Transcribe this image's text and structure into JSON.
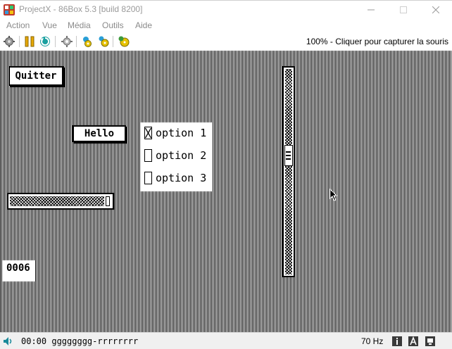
{
  "window": {
    "title": "ProjectX - 86Box 5.3 [build 8200]",
    "icon": "86box-app-icon",
    "controls": [
      "minimize-icon",
      "maximize-icon",
      "close-icon"
    ]
  },
  "menu": {
    "items": [
      "Action",
      "Vue",
      "Média",
      "Outils",
      "Aide"
    ]
  },
  "toolbar": {
    "icons": [
      "ctrl-alt-del-icon",
      "pause-icon",
      "hard-reset-icon",
      "settings-gear-icon",
      "sound-icon",
      "media-icon",
      "add-media-icon"
    ],
    "status_text": "100% - Cliquer pour capturer la souris"
  },
  "guest_screen": {
    "quit_button": "Quitter",
    "hello_button": "Hello",
    "options": [
      {
        "label": "option 1",
        "checked": true
      },
      {
        "label": "option 2",
        "checked": false
      },
      {
        "label": "option 3",
        "checked": false
      }
    ],
    "counter": "0006",
    "horizontal_slider_level": 0.95,
    "vertical_scroll_level": 0.4
  },
  "statusbar": {
    "icons": [
      "speaker-icon",
      "info-icon",
      "letter-a-icon",
      "network-icon"
    ],
    "text": "00:00 gggggggg-rrrrrrrr",
    "refresh_rate": "70 Hz"
  },
  "colors": {
    "menu_text": "#8a8a8a",
    "title_text": "#9a9a9a",
    "screen_fg": "#000000",
    "screen_bg": "#ffffff",
    "statusbar_bg": "#f0f0f0"
  }
}
